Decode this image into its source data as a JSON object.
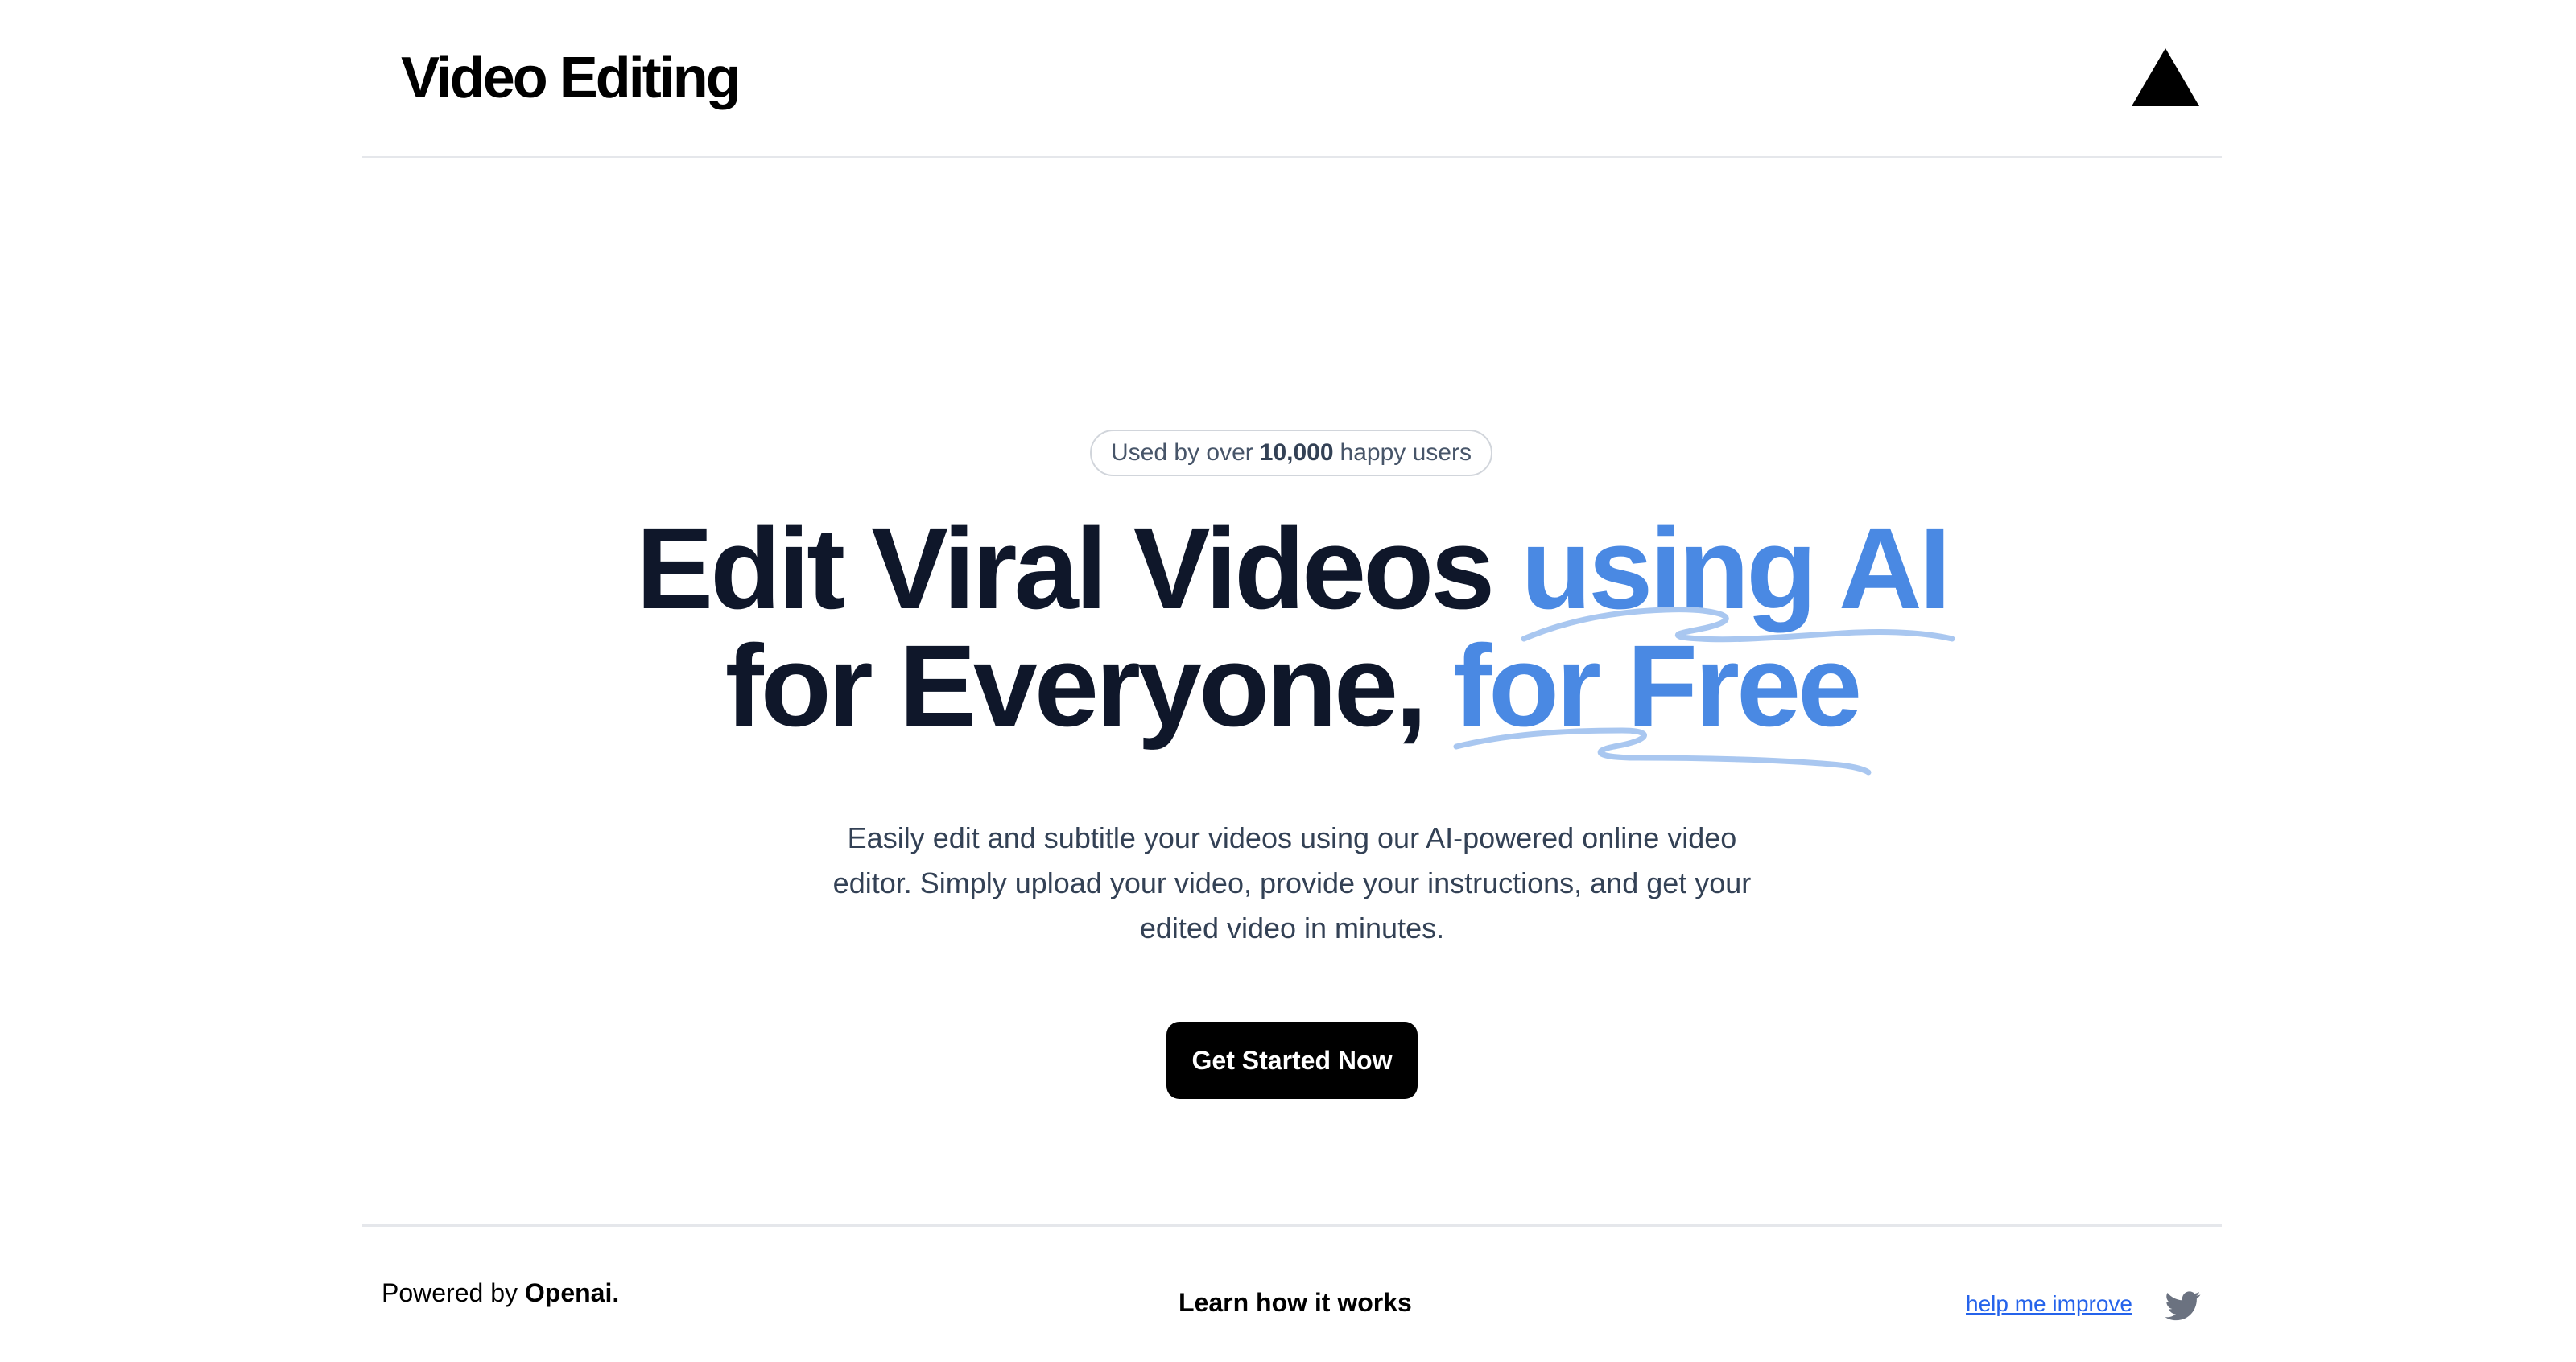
{
  "header": {
    "brand": "Video Editing",
    "logo_icon": "triangle-logo-icon"
  },
  "hero": {
    "badge": {
      "prefix": "Used by over",
      "count": "10,000",
      "suffix": "happy users"
    },
    "headline": {
      "line1_plain": "Edit Viral Videos ",
      "line1_accent": "using AI",
      "line2_plain": "for Everyone, ",
      "line2_accent": "for Free"
    },
    "subtitle": "Easily edit and subtitle your videos using our AI-powered online video editor. Simply upload your video, provide your instructions, and get your edited video in minutes.",
    "cta_label": "Get Started Now"
  },
  "footer": {
    "powered_prefix": "Powered by",
    "powered_org": "Openai.",
    "learn_label": "Learn how it works",
    "improve_label": "help me improve",
    "twitter_icon": "twitter-icon"
  },
  "colors": {
    "accent": "#4a89e3",
    "squiggle": "#a9c7f0",
    "heading": "#0f172a",
    "link": "#2563eb",
    "divider": "#e5e7eb",
    "icon_gray": "#6b7280"
  }
}
